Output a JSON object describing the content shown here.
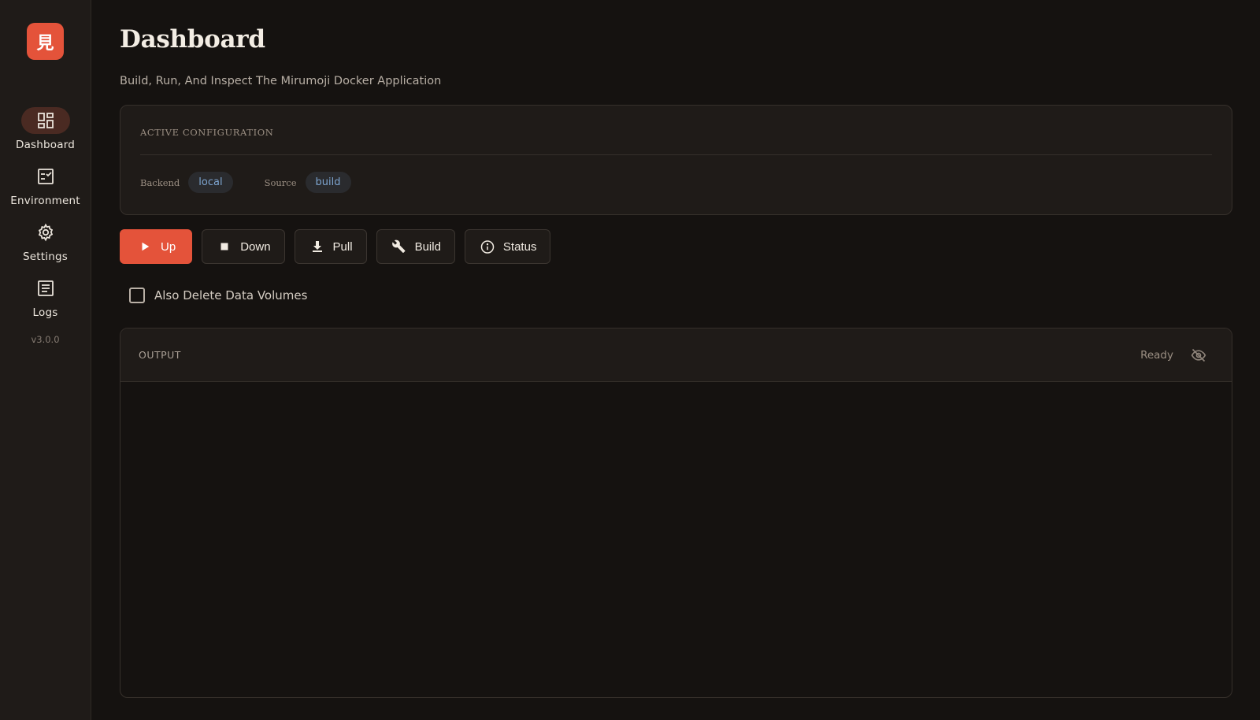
{
  "sidebar": {
    "logo_text": "見",
    "items": [
      {
        "label": "Dashboard",
        "icon": "dashboard-icon",
        "active": true
      },
      {
        "label": "Environment",
        "icon": "checklist-icon",
        "active": false
      },
      {
        "label": "Settings",
        "icon": "gear-icon",
        "active": false
      },
      {
        "label": "Logs",
        "icon": "document-icon",
        "active": false
      }
    ],
    "version": "v3.0.0"
  },
  "header": {
    "title": "Dashboard",
    "subtitle": "Build, Run, And Inspect The Mirumoji Docker Application"
  },
  "config": {
    "title": "ACTIVE CONFIGURATION",
    "backend_label": "Backend",
    "backend_value": "local",
    "source_label": "Source",
    "source_value": "build"
  },
  "actions": {
    "up": "Up",
    "down": "Down",
    "pull": "Pull",
    "build": "Build",
    "status": "Status"
  },
  "options": {
    "delete_volumes_label": "Also Delete Data Volumes",
    "delete_volumes_checked": false
  },
  "output": {
    "title": "OUTPUT",
    "status": "Ready"
  },
  "colors": {
    "accent": "#e4533a",
    "background": "#151210",
    "surface": "#1f1b18",
    "badge_text": "#7da4cf"
  }
}
